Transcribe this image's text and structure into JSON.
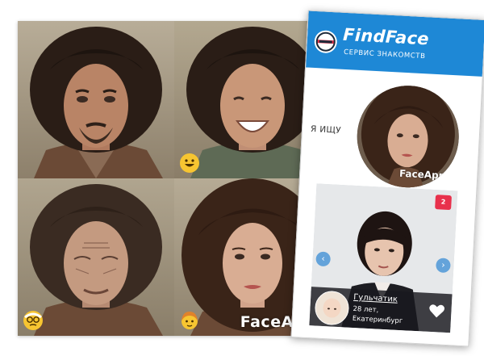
{
  "collage": {
    "watermark": "FaceApp",
    "panels": [
      {
        "label": "original",
        "filter": "none"
      },
      {
        "label": "smile",
        "filter": "smile-emoji"
      },
      {
        "label": "old",
        "filter": "old-emoji"
      },
      {
        "label": "female",
        "filter": "female-emoji"
      }
    ]
  },
  "app": {
    "title": "FindFace",
    "tagline": "СЕРВИС ЗНАКОМСТВ",
    "looking_for": "Я ИЩУ",
    "avatar_watermark": "FaceApp",
    "photo_count": "2",
    "profile": {
      "name": "Гульчатик",
      "age": "28 лет,",
      "city": "Екатеринбург"
    }
  },
  "colors": {
    "header": "#1e88d6",
    "badge": "#e8314c",
    "arrow": "#4c96d7"
  }
}
